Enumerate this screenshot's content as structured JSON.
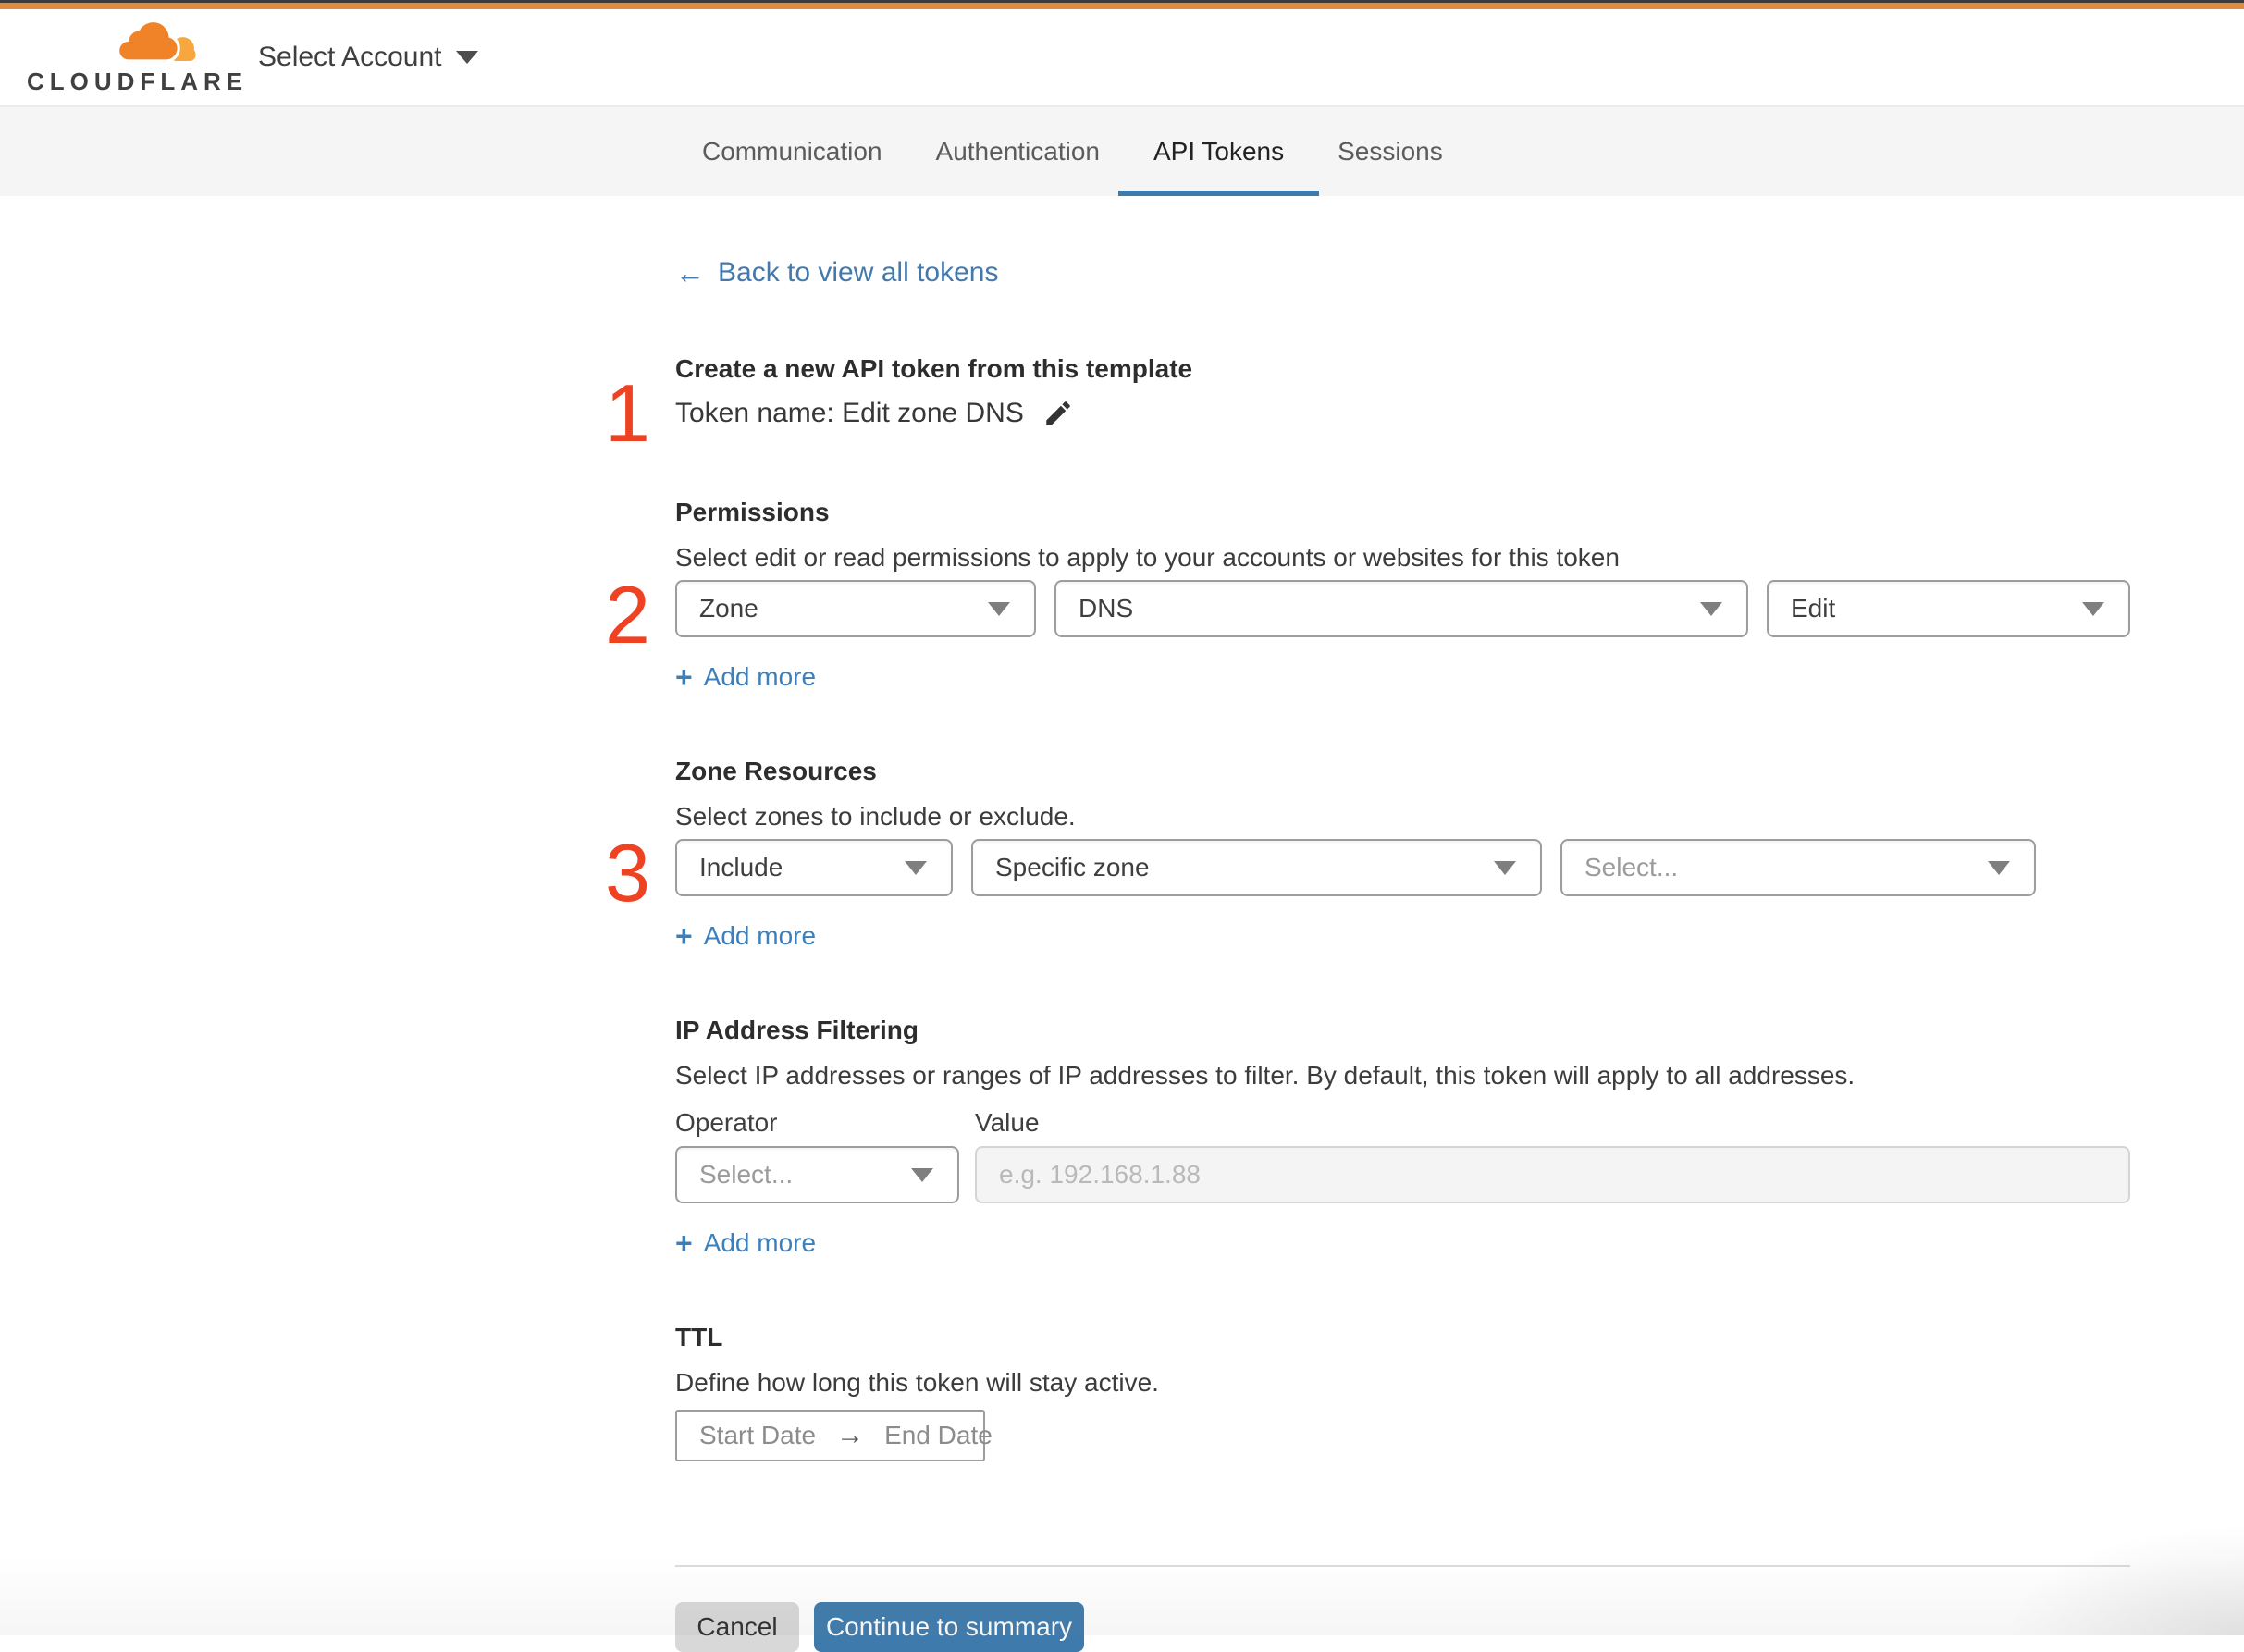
{
  "header": {
    "logo_text": "CLOUDFLARE",
    "account_label": "Select Account"
  },
  "tabs": [
    {
      "label": "Communication"
    },
    {
      "label": "Authentication"
    },
    {
      "label": "API Tokens"
    },
    {
      "label": "Sessions"
    }
  ],
  "back_link": {
    "arrow": "←",
    "label": "Back to view all tokens"
  },
  "step1": {
    "number": "1",
    "heading": "Create a new API token from this template",
    "token_name": "Token name: Edit zone DNS"
  },
  "permissions": {
    "number": "2",
    "heading": "Permissions",
    "description": "Select edit or read permissions to apply to your accounts or websites for this token",
    "select_scope": "Zone",
    "select_category": "DNS",
    "select_access": "Edit",
    "plus": "+",
    "add_more": "Add more"
  },
  "zone_resources": {
    "number": "3",
    "heading": "Zone Resources",
    "description": "Select zones to include or exclude.",
    "select_mode": "Include",
    "select_type": "Specific zone",
    "select_zone_placeholder": "Select...",
    "plus": "+",
    "add_more": "Add more"
  },
  "ip_filtering": {
    "heading": "IP Address Filtering",
    "description": "Select IP addresses or ranges of IP addresses to filter. By default, this token will apply to all addresses.",
    "operator_label": "Operator",
    "value_label": "Value",
    "operator_placeholder": "Select...",
    "value_placeholder": "e.g. 192.168.1.88",
    "plus": "+",
    "add_more": "Add more"
  },
  "ttl": {
    "heading": "TTL",
    "description": "Define how long this token will stay active.",
    "start_label": "Start Date",
    "arrow": "→",
    "end_label": "End Date"
  },
  "footer": {
    "cancel_label": "Cancel",
    "continue_label": "Continue to summary"
  },
  "colors": {
    "accent_orange": "#e08a3c",
    "step_red": "#ee4223",
    "link_blue": "#4379ab",
    "active_blue": "#3e7bac"
  }
}
